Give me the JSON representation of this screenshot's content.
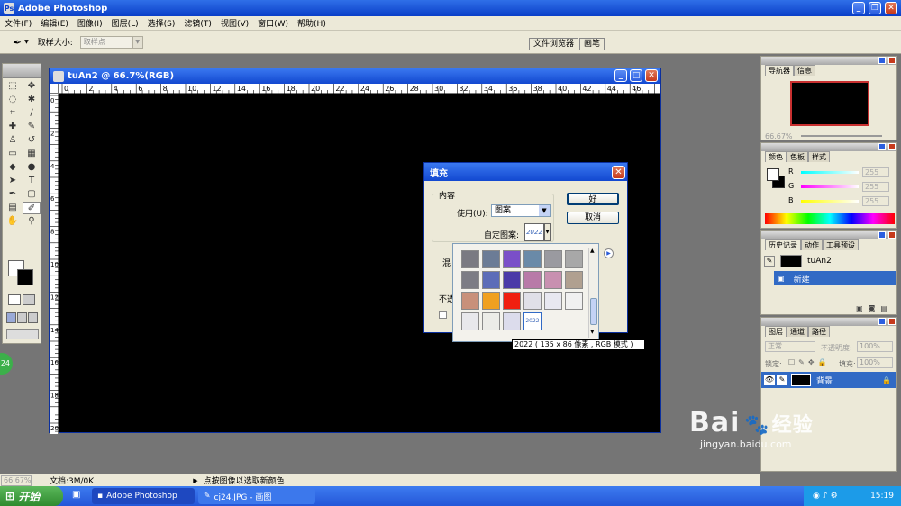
{
  "app": {
    "title": "Adobe Photoshop"
  },
  "menu": [
    "文件(F)",
    "编辑(E)",
    "图像(I)",
    "图层(L)",
    "选择(S)",
    "滤镜(T)",
    "视图(V)",
    "窗口(W)",
    "帮助(H)"
  ],
  "options": {
    "sample_size_label": "取样大小:",
    "sample_size_value": "取样点"
  },
  "wells": {
    "file_browser": "文件浏览器",
    "brushes": "画笔"
  },
  "document": {
    "title": "tuAn2 @ 66.7%(RGB)",
    "ruler_h": [
      "0",
      "2",
      "4",
      "6",
      "8",
      "10",
      "12",
      "14",
      "16",
      "18",
      "20",
      "22",
      "24",
      "26",
      "28",
      "30",
      "32",
      "34",
      "36",
      "38",
      "40",
      "42",
      "44",
      "46"
    ],
    "ruler_v": [
      "0",
      "2",
      "4",
      "6",
      "8",
      "10",
      "12",
      "14",
      "16",
      "18",
      "20"
    ]
  },
  "fill_dialog": {
    "title": "填充",
    "content_group": "内容",
    "use_label": "使用(U):",
    "use_value": "图案",
    "custom_pattern_label": "自定图案:",
    "ok": "好",
    "cancel": "取消",
    "blend_group_partial": "混",
    "opacity_partial": "不透"
  },
  "pattern_picker": {
    "swatches": [
      "#7a7a82",
      "#6c7c96",
      "#7a4fc8",
      "#6a8aa8",
      "#9a9aa0",
      "#a8a8a8",
      "#7c7c84",
      "#5c6cb8",
      "#4a3aa8",
      "#b87aa8",
      "#c890b0",
      "#b0a090",
      "#c8907a",
      "#f0a020",
      "#f02010",
      "#e0e0e8",
      "#e8e8f0",
      "#f0f0f0",
      "#e8e8ec",
      "#ecece8",
      "#dcdcec"
    ],
    "pattern_label": "2022",
    "tooltip": "2022 ( 135 x 86 像素 , RGB 模式 )"
  },
  "navigator": {
    "tabs": [
      "导航器",
      "信息"
    ],
    "zoom": "66.67%"
  },
  "color_panel": {
    "tabs": [
      "颜色",
      "色板",
      "样式"
    ],
    "channels": [
      {
        "label": "R",
        "value": "255"
      },
      {
        "label": "G",
        "value": "255"
      },
      {
        "label": "B",
        "value": "255"
      }
    ]
  },
  "history": {
    "tabs": [
      "历史记录",
      "动作",
      "工具预设"
    ],
    "snapshot": "tuAn2",
    "items": [
      "新建"
    ]
  },
  "layers": {
    "tabs": [
      "图层",
      "通道",
      "路径"
    ],
    "mode": "正常",
    "opacity_label": "不透明度:",
    "opacity_value": "100%",
    "lock_label": "锁定:",
    "fill_label": "填充:",
    "fill_value": "100%",
    "layer_name": "背景"
  },
  "status": {
    "zoom": "66.67%",
    "doc": "文档:3M/0K",
    "hint": "点按图像以选取新颜色"
  },
  "taskbar": {
    "start": "开始",
    "tasks": [
      "Adobe Photoshop",
      "cj24.JPG - 画图"
    ],
    "time": "15:19"
  },
  "watermark": {
    "line1": "Bai",
    "line2": "经验",
    "url": "jingyan.baidu.com"
  },
  "colors": {
    "title_blue": "#0a3fc8",
    "canvas": "#000000",
    "dialog_bg": "#ece9d8"
  }
}
